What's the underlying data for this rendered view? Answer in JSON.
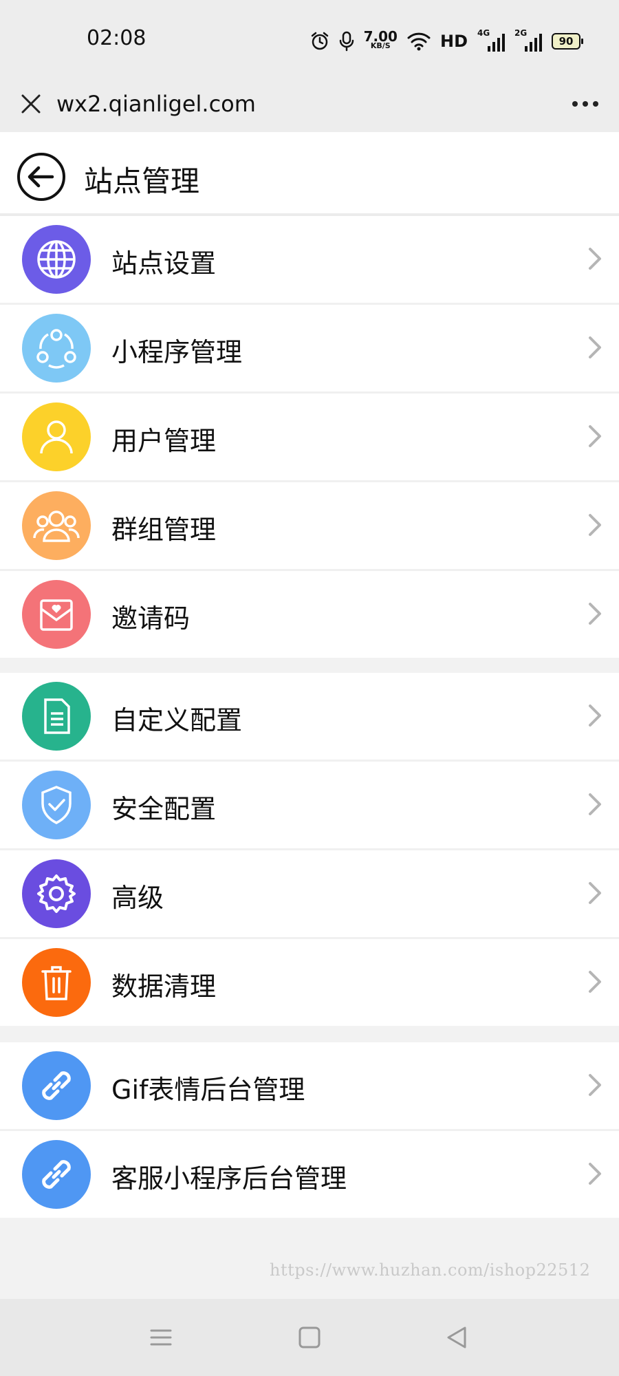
{
  "status_bar": {
    "time": "02:08",
    "net_speed_value": "7.00",
    "net_speed_unit": "KB/S",
    "hd_label": "HD",
    "sim1_label": "4G",
    "sim2_label": "2G",
    "battery": "90"
  },
  "browser": {
    "url": "wx2.qianligel.com",
    "close_icon": "close-icon",
    "more_icon": "more-icon"
  },
  "header": {
    "title": "站点管理",
    "back_icon": "back-arrow-icon"
  },
  "groups": [
    {
      "items": [
        {
          "label": "站点设置",
          "icon": "globe-icon",
          "color": "#6c5ce7"
        },
        {
          "label": "小程序管理",
          "icon": "share-nodes-icon",
          "color": "#7ec8f5"
        },
        {
          "label": "用户管理",
          "icon": "user-icon",
          "color": "#fcd12a"
        },
        {
          "label": "群组管理",
          "icon": "group-icon",
          "color": "#fdae5f"
        },
        {
          "label": "邀请码",
          "icon": "envelope-heart-icon",
          "color": "#f47378"
        }
      ]
    },
    {
      "items": [
        {
          "label": "自定义配置",
          "icon": "document-icon",
          "color": "#27b38d"
        },
        {
          "label": "安全配置",
          "icon": "shield-check-icon",
          "color": "#6eb0f7"
        },
        {
          "label": "高级",
          "icon": "gear-icon",
          "color": "#6a4de0"
        },
        {
          "label": "数据清理",
          "icon": "trash-icon",
          "color": "#fb6a0e"
        }
      ]
    },
    {
      "items": [
        {
          "label": "Gif表情后台管理",
          "icon": "link-icon",
          "color": "#4f97f3"
        },
        {
          "label": "客服小程序后台管理",
          "icon": "link-icon",
          "color": "#4f97f3"
        }
      ]
    }
  ],
  "watermark": "https://www.huzhan.com/ishop22512",
  "nav": {
    "menu_icon": "menu-icon",
    "home_icon": "home-square-icon",
    "back_icon": "back-triangle-icon"
  }
}
